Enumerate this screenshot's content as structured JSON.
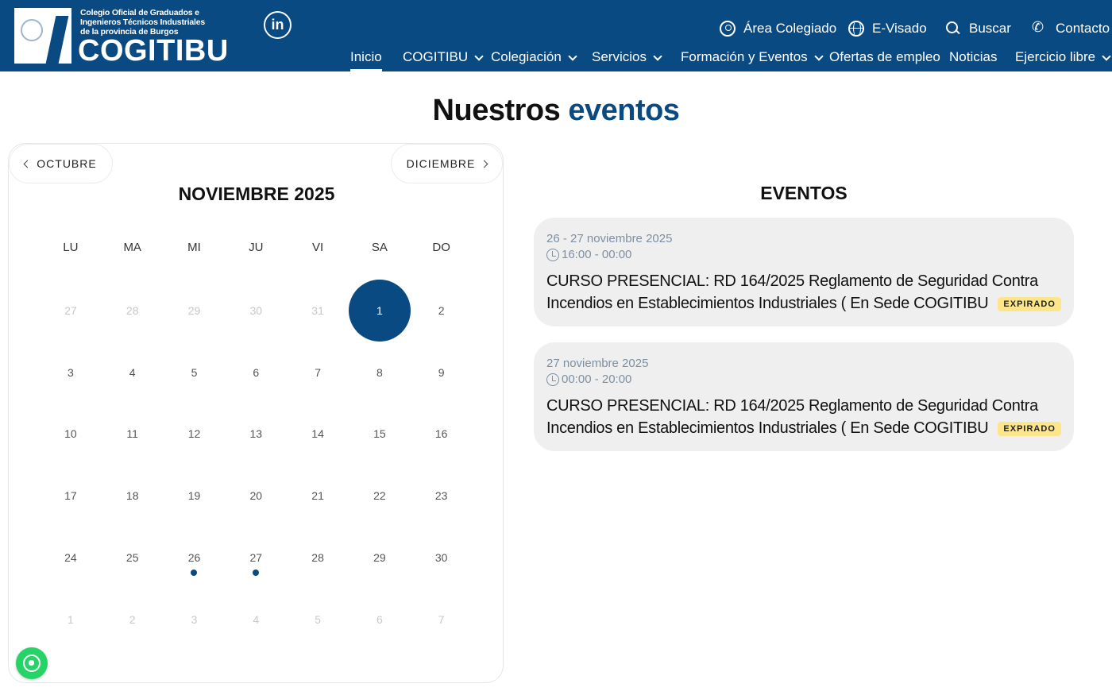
{
  "header": {
    "org_line1": "Colegio Oficial de Graduados e",
    "org_line2": "Ingenieros Técnicos Industriales",
    "org_line3": "de la provincia de Burgos",
    "brand": "COGITIBU",
    "social": "in",
    "utility": {
      "area": "Área Colegiado",
      "visado": "E-Visado",
      "buscar": "Buscar",
      "contacto": "Contacto"
    },
    "nav": [
      "Inicio",
      "COGITIBU",
      "Colegiación",
      "Servicios",
      "Formación y Eventos",
      "Ofertas de empleo",
      "Noticias",
      "Ejercicio libre"
    ]
  },
  "page": {
    "title_main": "Nuestros",
    "title_accent": "eventos"
  },
  "calendar": {
    "prev": "OCTUBRE",
    "next": "DICIEMBRE",
    "title": "NOVIEMBRE 2025",
    "weekdays": [
      "LU",
      "MA",
      "MI",
      "JU",
      "VI",
      "SA",
      "DO"
    ],
    "days": [
      "27",
      "28",
      "29",
      "30",
      "31",
      "1",
      "2",
      "3",
      "4",
      "5",
      "6",
      "7",
      "8",
      "9",
      "10",
      "11",
      "12",
      "13",
      "14",
      "15",
      "16",
      "17",
      "18",
      "19",
      "20",
      "21",
      "22",
      "23",
      "24",
      "25",
      "26",
      "27",
      "28",
      "29",
      "30",
      "1",
      "2",
      "3",
      "4",
      "5",
      "6",
      "7"
    ]
  },
  "events": {
    "title": "EVENTOS",
    "items": [
      {
        "date": "26 - 27 noviembre 2025",
        "time": "16:00 - 00:00",
        "name": "CURSO PRESENCIAL: RD 164/2025 Reglamento de Seguridad Contra Incendios en Establecimientos Industriales ( En Sede COGITIBU",
        "badge": "EXPIRADO"
      },
      {
        "date": "27 noviembre 2025",
        "time": "00:00 - 20:00",
        "name": "CURSO PRESENCIAL: RD 164/2025 Reglamento de Seguridad Contra Incendios en Establecimientos Industriales ( En Sede COGITIBU",
        "badge": "EXPIRADO"
      }
    ]
  }
}
